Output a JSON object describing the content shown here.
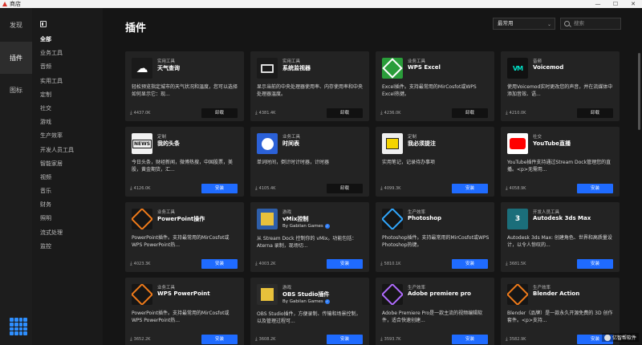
{
  "window": {
    "title": "商店",
    "minimize": "—",
    "maximize": "☐",
    "close": "✕"
  },
  "rail": {
    "items": [
      {
        "label": "发现"
      },
      {
        "label": "插件"
      },
      {
        "label": "图标"
      }
    ]
  },
  "categories": [
    "全部",
    "业务工具",
    "音频",
    "实用工具",
    "定制",
    "社交",
    "游戏",
    "生产效率",
    "开发人员工具",
    "智能家居",
    "视频",
    "音乐",
    "财务",
    "照明",
    "流式处理",
    "监控"
  ],
  "main": {
    "title": "插件",
    "sort": "最常用",
    "search_placeholder": "搜索"
  },
  "cards": [
    {
      "category": "实用工具",
      "name": "天气查询",
      "desc": "轻松预览指定城市的天气状况和温度，您可以选择如何显示它：现...",
      "downloads": "4437.0K",
      "action": "卸载",
      "icon": "weather-icon",
      "bg": "#1a1a1a"
    },
    {
      "category": "实用工具",
      "name": "系统监视器",
      "desc": "显示当前的中央处理器使用率、内存使用率和中央处理器温度。",
      "downloads": "4381.4K",
      "action": "卸载",
      "icon": "monitor-icon",
      "bg": "#1a1a1a"
    },
    {
      "category": "业务工具",
      "name": "WPS Excel",
      "desc": "Excel插件。支持最常用的MirCosfot或WPS Excel热键。",
      "downloads": "4236.0K",
      "action": "卸载",
      "icon": "excel-icon",
      "bg": "#2a9d3a"
    },
    {
      "category": "音频",
      "name": "Voicemod",
      "desc": "使用Voicemod实时更改您的声音，并在流媒体中添加音效、语...",
      "downloads": "4210.0K",
      "action": "卸载",
      "icon": "voicemod-icon",
      "bg": "#111"
    },
    {
      "category": "定制",
      "name": "我的头条",
      "desc": "今日头条，财经新闻，微博热搜，中国股票，美股，黄金期货，汇...",
      "downloads": "4126.0K",
      "action": "安装",
      "icon": "news-icon",
      "bg": "#f2f2f2"
    },
    {
      "category": "业务工具",
      "name": "时间表",
      "desc": "单词时间，倒计时计时器，计时器",
      "downloads": "4105.4K",
      "action": "卸载",
      "icon": "clock-icon",
      "bg": "#2b61d8"
    },
    {
      "category": "定制",
      "name": "我必须提注",
      "desc": "实用笔记，记录待办事项",
      "downloads": "4099.3K",
      "action": "安装",
      "icon": "note-icon",
      "bg": "#f0f0f0"
    },
    {
      "category": "社交",
      "name": "YouTube直播",
      "desc": "YouTube插件支持通过Stream Dock管理您的直播。<p>无需用...",
      "downloads": "4058.9K",
      "action": "安装",
      "icon": "youtube-icon",
      "bg": "#fff"
    },
    {
      "category": "业务工具",
      "name": "PowerPoint操作",
      "desc": "PowerPoint插件。支持最常用的MirCosfot或WPS PowerPoint热...",
      "downloads": "4023.3K",
      "action": "安装",
      "icon": "powerpoint-icon",
      "bg": "#161616"
    },
    {
      "category": "游戏",
      "name": "vMix控制",
      "author": "By Gabilan Games",
      "desc": "从 Stream Dock 控制你的 vMix。功能包括：Aterna 录制，现场切...",
      "downloads": "4003.2K",
      "action": "安装",
      "icon": "vmix-icon",
      "bg": "#2e5ea8"
    },
    {
      "category": "生产效率",
      "name": "Photoshop",
      "desc": "Photoshop插件。支持最常用的MirCosfot或WPS Photoshop热键。",
      "downloads": "5810.1K",
      "action": "安装",
      "icon": "photoshop-icon",
      "bg": "#161616"
    },
    {
      "category": "开发人员工具",
      "name": "Autodesk 3ds Max",
      "desc": "Autodesk 3ds Max: 创建角色、世界和高质量设计，以令人惊叹的...",
      "downloads": "3681.5K",
      "action": "安装",
      "icon": "3dsmax-icon",
      "bg": "#1b6e7a"
    },
    {
      "category": "业务工具",
      "name": "WPS PowerPoint",
      "desc": "PowerPoint插件。支持最常用的MirCosfot或WPS PowerPoint热...",
      "downloads": "3652.2K",
      "action": "安装",
      "icon": "wps-powerpoint-icon",
      "bg": "#161616"
    },
    {
      "category": "游戏",
      "name": "OBS Studio插件",
      "author": "By Gabilan Games",
      "desc": "OBS Studio插件，方便录制、传输和场景控制，以及管理过程可...",
      "downloads": "3608.2K",
      "action": "安装",
      "icon": "obs-icon",
      "bg": "#2b2b2b"
    },
    {
      "category": "生产效率",
      "name": "Adobe premiere pro",
      "desc": "Adobe Premiere Pro是一款主流的视频编辑软件，适合快速创建...",
      "downloads": "3593.7K",
      "action": "安装",
      "icon": "premiere-icon",
      "bg": "#161616"
    },
    {
      "category": "生产效率",
      "name": "Blender Action",
      "desc": "Blender（品牌）是一款永久开源免费的 3D 创作套件。<p>支持...",
      "downloads": "3582.9K",
      "action": "安装",
      "icon": "blender-icon",
      "bg": "#161616"
    }
  ],
  "watermark": "亿智帮软件"
}
